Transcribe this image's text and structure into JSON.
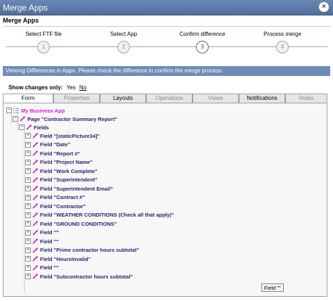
{
  "window": {
    "title": "Merge Apps"
  },
  "section_title": "Merge Apps",
  "steps": [
    {
      "label": "Select FTF file",
      "number": "1",
      "active": false
    },
    {
      "label": "Select App",
      "number": "2",
      "active": false
    },
    {
      "label": "Confirm difference",
      "number": "3",
      "active": true
    },
    {
      "label": "Process merge",
      "number": "4",
      "active": false
    }
  ],
  "banner": "Viewing Differences in Apps. Please check the difference to confirm the merge process.",
  "show_changes": {
    "label": "Show changes only:",
    "yes": "Yes",
    "no": "No"
  },
  "tabs": [
    {
      "label": "Form",
      "state": "selected"
    },
    {
      "label": "Properties",
      "state": "disabled"
    },
    {
      "label": "Layouts",
      "state": "enabled"
    },
    {
      "label": "Operations",
      "state": "disabled"
    },
    {
      "label": "Views",
      "state": "disabled"
    },
    {
      "label": "Notifications",
      "state": "enabled"
    },
    {
      "label": "Roles",
      "state": "disabled"
    }
  ],
  "tree": {
    "app": "My Business App",
    "page": "Page \"Contractor Summary Report\"",
    "fields_group": "Fields",
    "fields": [
      "Field \"[staticPicture34]\"",
      "Field \"Date\"",
      "Field \"Report #\"",
      "Field \"Project Name\"",
      "Field \"Work Complete\"",
      "Field \"Superintendent\"",
      "Field \"Superintendent Email\"",
      "Field \"Contract #\"",
      "Field \"Contractor\"",
      "Field \"WEATHER CONDITIONS (Check all that apply)\"",
      "Field \"GROUND CONDITIONS\"",
      "Field \"\"",
      "Field \"\"",
      "Field \"Prime contractor hours subtotal\"",
      "Field \"HoursInvalid\"",
      "Field \"\"",
      "Field \"Subcontractor hours subtotal\""
    ]
  },
  "tooltip": "Field \"\"",
  "colors": {
    "titlebar": "#5b7aa8",
    "banner": "#6f8cb6",
    "app_text": "#d01fd0",
    "node_text": "#2a1f6e"
  },
  "icons": {
    "node": "magenta-wand-icon",
    "expander": "plus-box-icon"
  }
}
